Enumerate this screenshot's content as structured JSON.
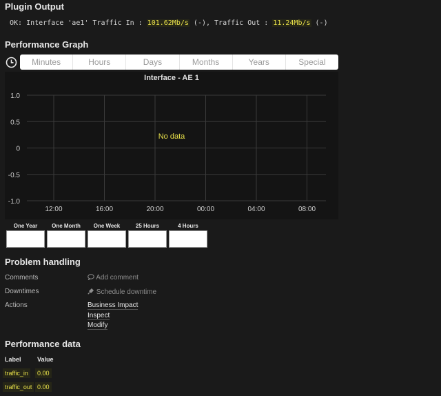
{
  "plugin_output": {
    "title": "Plugin Output",
    "prefix": "OK: Interface 'ae1' Traffic In : ",
    "traffic_in": "101.62Mb/s",
    "middle": " (-), Traffic Out : ",
    "traffic_out": "11.24Mb/s",
    "suffix": " (-)"
  },
  "performance_graph": {
    "title": "Performance Graph",
    "clock_icon": "clock-icon",
    "tabs": [
      "Minutes",
      "Hours",
      "Days",
      "Months",
      "Years",
      "Special"
    ]
  },
  "chart_data": {
    "type": "line",
    "title": "Interface - AE 1",
    "no_data_text": "No data",
    "x": [],
    "series": [],
    "xticks": [
      "12:00",
      "16:00",
      "20:00",
      "00:00",
      "04:00",
      "08:00"
    ],
    "yticks": [
      "1.0",
      "0.5",
      "0",
      "-0.5",
      "-1.0"
    ],
    "ylim": [
      -1,
      1
    ],
    "grid": true
  },
  "thumbnails": [
    {
      "label": "One Year"
    },
    {
      "label": "One Month"
    },
    {
      "label": "One Week"
    },
    {
      "label": "25 Hours"
    },
    {
      "label": "4 Hours"
    }
  ],
  "problem_handling": {
    "title": "Problem handling",
    "comments_label": "Comments",
    "add_comment": "Add comment",
    "downtimes_label": "Downtimes",
    "schedule_downtime": "Schedule downtime",
    "actions_label": "Actions",
    "actions": [
      "Business Impact",
      "Inspect",
      "Modify"
    ]
  },
  "performance_data": {
    "title": "Performance data",
    "col_label": "Label",
    "col_value": "Value",
    "rows": [
      {
        "label": "traffic_in",
        "value": "0.00"
      },
      {
        "label": "traffic_out",
        "value": "0.00"
      }
    ]
  },
  "colors": {
    "highlight": "#e8e04a",
    "background": "#1a1a1a",
    "graph_background": "#141414"
  }
}
